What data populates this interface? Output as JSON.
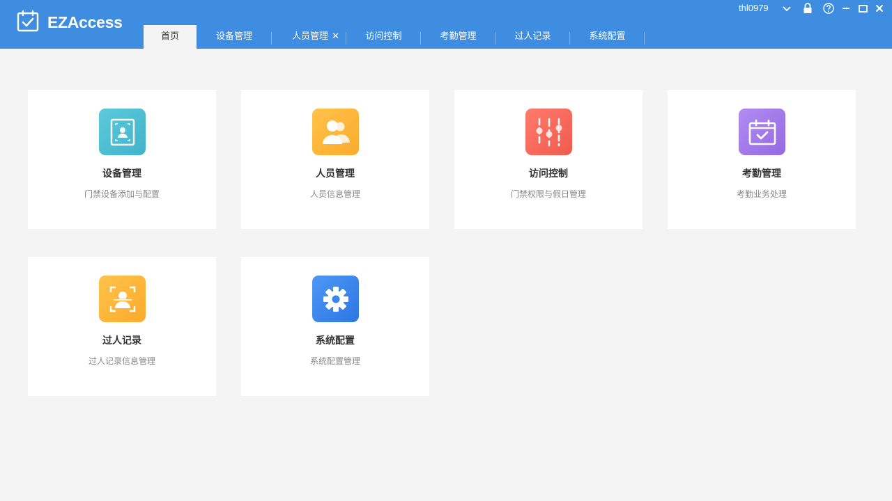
{
  "app": {
    "name": "EZAccess"
  },
  "user": {
    "name": "thl0979"
  },
  "tabs": [
    {
      "label": "首页",
      "active": true
    },
    {
      "label": "设备管理"
    },
    {
      "label": "人员管理",
      "closable": true
    },
    {
      "label": "访问控制"
    },
    {
      "label": "考勤管理"
    },
    {
      "label": "过人记录"
    },
    {
      "label": "系统配置"
    }
  ],
  "cards": [
    {
      "title": "设备管理",
      "desc": "门禁设备添加与配置",
      "icon": "device-icon",
      "color": "#4fbfd2"
    },
    {
      "title": "人员管理",
      "desc": "人员信息管理",
      "icon": "people-icon",
      "color": "#fdb83a"
    },
    {
      "title": "访问控制",
      "desc": "门禁权限与假日管理",
      "icon": "sliders-icon",
      "color": "#f5685a"
    },
    {
      "title": "考勤管理",
      "desc": "考勤业务处理",
      "icon": "calendar-check-icon",
      "color": "#a07ae8"
    },
    {
      "title": "过人记录",
      "desc": "过人记录信息管理",
      "icon": "face-scan-icon",
      "color": "#fdb83a"
    },
    {
      "title": "系统配置",
      "desc": "系统配置管理",
      "icon": "gear-icon",
      "color": "#3a86ee"
    }
  ],
  "colors": {
    "header": "#3f8de0",
    "background": "#f4f4f4"
  }
}
